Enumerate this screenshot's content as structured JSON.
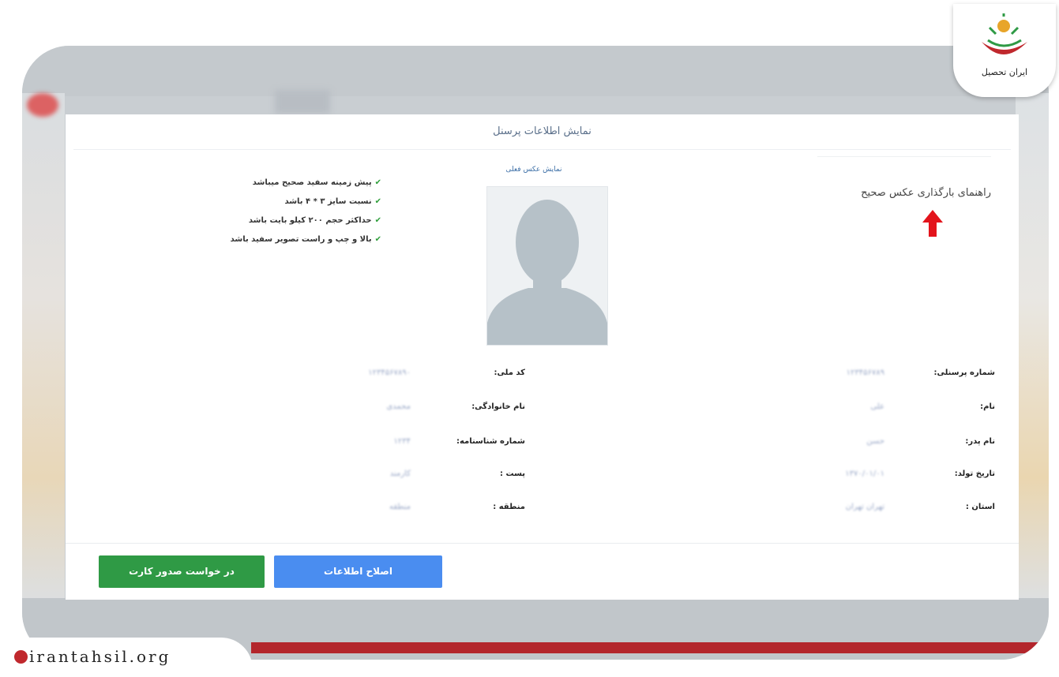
{
  "panel": {
    "title": "نمایش اطلاعات پرسنل",
    "guide_title": "راهنمای بارگذاری عکس صحیح",
    "photo_caption": "نمایش عکس فعلی"
  },
  "rules": [
    "پیش زمینه سفید صحیح میباشد",
    "نسبت سایز ۳ * ۴ باشد",
    "حداکثر حجم ۲۰۰ کیلو بایت باشد",
    "بالا و چپ و راست تصویر سفید باشد"
  ],
  "fields_right": [
    {
      "label": "شماره پرسنلی:",
      "value": "۱۲۳۴۵۶۷۸۹"
    },
    {
      "label": "نام:",
      "value": "علی"
    },
    {
      "label": "نام پدر:",
      "value": "حسن"
    },
    {
      "label": "تاریخ تولد:",
      "value": "۱۳۷۰/۰۱/۰۱"
    },
    {
      "label": "استان :",
      "value": "تهران تهران"
    }
  ],
  "fields_left": [
    {
      "label": "کد ملی:",
      "value": "۱۲۳۴۵۶۷۸۹۰"
    },
    {
      "label": "نام خانوادگی:",
      "value": "محمدی"
    },
    {
      "label": "شماره شناسنامه:",
      "value": "۱۲۳۴"
    },
    {
      "label": "پست :",
      "value": "کارمند"
    },
    {
      "label": "منطقه :",
      "value": "منطقه"
    }
  ],
  "buttons": {
    "edit_label": "اصلاح اطلاعات",
    "card_label": "در خواست صدور کارت"
  },
  "logo": {
    "text": "ایران تحصیل"
  },
  "site": {
    "url": "irantahsil.org"
  },
  "icons": {
    "check": "check-icon",
    "arrow": "red-up-arrow-icon",
    "avatar": "person-silhouette-icon",
    "globe": "globe-icon"
  },
  "colors": {
    "primary": "#4a8df0",
    "success": "#2f9a45",
    "accent": "#b3262c"
  }
}
